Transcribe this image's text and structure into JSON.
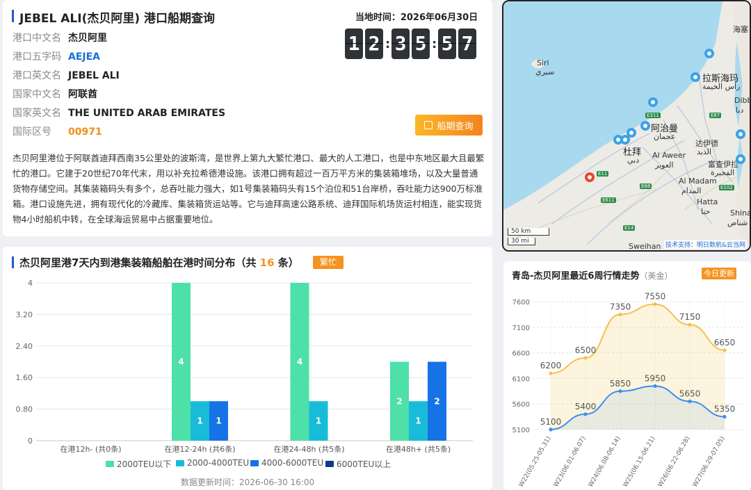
{
  "info": {
    "title": "JEBEL ALI(杰贝阿里) 港口船期查询",
    "fields": [
      {
        "key": "港口中文名",
        "value": "杰贝阿里",
        "style": "dark"
      },
      {
        "key": "港口五字码",
        "value": "AEJEA",
        "style": "blue"
      },
      {
        "key": "港口英文名",
        "value": "JEBEL ALI",
        "style": "dark"
      },
      {
        "key": "国家中文名",
        "value": "阿联酋",
        "style": "dark"
      },
      {
        "key": "国家英文名",
        "value": "THE UNITED ARAB EMIRATES",
        "style": "dark"
      },
      {
        "key": "国际区号",
        "value": "00971",
        "style": "orange"
      }
    ],
    "clock_label": "当地时间：2026年06月30日",
    "clock_digits": [
      "1",
      "2",
      "3",
      "5",
      "5",
      "7"
    ],
    "query_button": "船期查询",
    "description": "杰贝阿里港位于阿联酋迪拜西南35公里处的波斯湾，是世界上第九大繁忙港口、最大的人工港口，也是中东地区最大且最繁忙的港口。它建于20世纪70年代末，用以补充拉希德港设施。该港口拥有超过一百万平方米的集装箱堆场，以及大量普通货物存储空间。其集装箱码头有多个，总吞吐能力强大，如1号集装箱码头有15个泊位和51台岸桥，吞吐能力达900万标准箱。港口设施先进，拥有现代化的冷藏库、集装箱货运站等。它与迪拜高速公路系统、迪拜国际机场货运村相连，能实现货物4小时船机中转，在全球海运贸易中占据重要地位。"
  },
  "map": {
    "labels": [
      {
        "text": "Siri",
        "big": false
      },
      {
        "text": "سيري",
        "big": false
      },
      {
        "text": "拉斯海玛",
        "big": true
      },
      {
        "text": "رأس الخيمة",
        "big": false
      },
      {
        "text": "阿治曼",
        "big": true
      },
      {
        "text": "عجمان",
        "big": false
      },
      {
        "text": "杜拜",
        "big": true
      },
      {
        "text": "دبي",
        "big": false
      },
      {
        "text": "Al Aweer",
        "big": false
      },
      {
        "text": "العوير",
        "big": false
      },
      {
        "text": "达伊德",
        "big": false
      },
      {
        "text": "الذيد",
        "big": false
      },
      {
        "text": "富查伊拉",
        "big": false
      },
      {
        "text": "الفجيرة",
        "big": false
      },
      {
        "text": "Al Madam",
        "big": false
      },
      {
        "text": "المدام",
        "big": false
      },
      {
        "text": "Hatta",
        "big": false
      },
      {
        "text": "حتا",
        "big": false
      },
      {
        "text": "海塞",
        "big": false
      },
      {
        "text": "Dibba",
        "big": false
      },
      {
        "text": "دبا",
        "big": false
      },
      {
        "text": "Shinas",
        "big": false
      },
      {
        "text": "شناص",
        "big": false
      },
      {
        "text": "Sweihan",
        "big": false
      }
    ],
    "roads": [
      "E311",
      "E87",
      "E11",
      "E66",
      "E611",
      "E14",
      "E102"
    ],
    "scale_km": "50 km",
    "scale_mi": "30 mi",
    "credit": "技术支持：明日数航&云当网"
  },
  "dist": {
    "title_prefix": "杰贝阿里港7天内到港集装箱船舶在港时间分布（共 ",
    "title_count": "16",
    "title_suffix": " 条）",
    "badge": "繁忙",
    "update_note": "数据更新时间：2026-06-30 16:00"
  },
  "trend": {
    "title": "青岛-杰贝阿里最近6周行情走势",
    "unit": "（美金）",
    "badge": "今日更新"
  },
  "chart_data": [
    {
      "type": "bar",
      "title": "杰贝阿里港7天内到港集装箱船舶在港时间分布（共 16 条）",
      "categories": [
        "在港12h- (共0条)",
        "在港12-24h (共6条)",
        "在港24-48h (共5条)",
        "在港48h+ (共5条)"
      ],
      "series": [
        {
          "name": "2000TEU以下",
          "color": "#4de0a8",
          "values": [
            0,
            4,
            4,
            2
          ]
        },
        {
          "name": "2000-4000TEU",
          "color": "#19bcd8",
          "values": [
            0,
            1,
            1,
            1
          ]
        },
        {
          "name": "4000-6000TEU",
          "color": "#1573e6",
          "values": [
            0,
            1,
            0,
            2
          ]
        },
        {
          "name": "6000TEU以上",
          "color": "#0d3b86",
          "values": [
            0,
            0,
            0,
            0
          ]
        }
      ],
      "yticks": [
        "0",
        "0.80",
        "1.60",
        "2.40",
        "3.20",
        "4"
      ],
      "ylim": [
        0,
        4
      ],
      "grid": true,
      "legend": "bottom"
    },
    {
      "type": "line",
      "title": "青岛-杰贝阿里最近6周行情走势",
      "categories": [
        "W22(05.25-05.31)",
        "W23(06.01-06.07)",
        "W24(06.08-06.14)",
        "W25(06.15-06.21)",
        "W26(06.22-06.28)",
        "W27(06.29-07.05)"
      ],
      "series": [
        {
          "color": "#f5c04a",
          "values": [
            6200,
            6500,
            7350,
            7550,
            7150,
            6650
          ]
        },
        {
          "color": "#3a8ff0",
          "values": [
            5100,
            5400,
            5850,
            5950,
            5650,
            5350
          ]
        }
      ],
      "yticks": [
        "5100",
        "5600",
        "6100",
        "6600",
        "7100",
        "7600"
      ],
      "ylim": [
        5100,
        7600
      ],
      "grid": true
    }
  ]
}
